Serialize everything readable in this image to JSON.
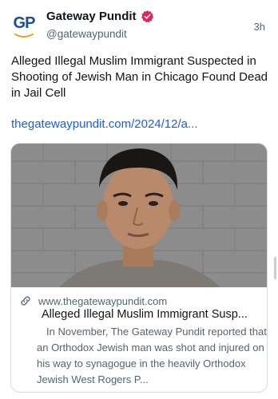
{
  "author": {
    "avatar_text": "GP",
    "display_name": "Gateway Pundit",
    "handle": "@gatewaypundit",
    "timestamp": "3h",
    "verified_color": "#e0245e",
    "avatar_color": "#1f4c8f",
    "avatar_swoosh_color": "#e8a317"
  },
  "post": {
    "text": "Alleged Illegal Muslim Immigrant Suspected in Shooting of Jewish Man in Chicago Found Dead in Jail Cell",
    "link": "thegatewaypundit.com/2024/12/a...",
    "link_color": "#1d5fd1"
  },
  "card": {
    "domain": "www.thegatewaypundit.com",
    "title": "Alleged Illegal Muslim Immigrant Susp...",
    "description": "In November, The Gateway Pundit reported that an Orthodox Jewish man was shot and injured on his way to synagogue in the heavily Orthodox Jewish West Rogers P...",
    "image_icon": "mugshot-photo"
  }
}
